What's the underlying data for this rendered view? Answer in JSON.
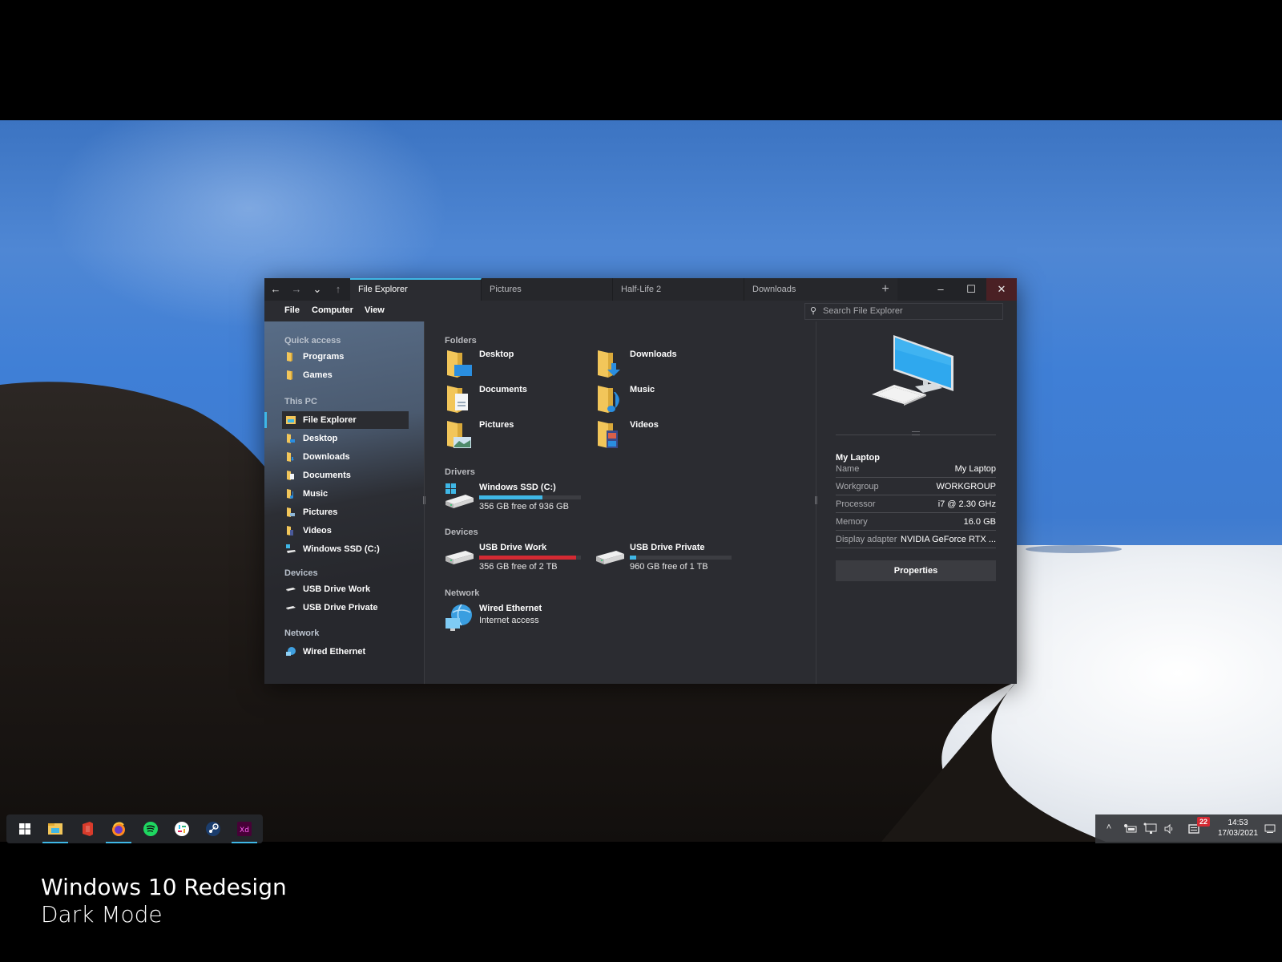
{
  "window": {
    "nav": {
      "back": "←",
      "forward": "→",
      "recent": "⌄",
      "up": "↑"
    },
    "tabs": [
      {
        "label": "File Explorer",
        "active": true
      },
      {
        "label": "Pictures",
        "active": false
      },
      {
        "label": "Half-Life 2",
        "active": false
      },
      {
        "label": "Downloads",
        "active": false
      }
    ],
    "new_tab": "+",
    "controls": {
      "minimize": "–",
      "maximize": "☐",
      "close": "✕"
    },
    "menu": [
      "File",
      "Computer",
      "View"
    ],
    "search_placeholder": "Search File Explorer"
  },
  "sidebar": {
    "sections": [
      {
        "label": "Quick access",
        "items": [
          {
            "label": "Programs",
            "icon": "folder-icon"
          },
          {
            "label": "Games",
            "icon": "folder-icon"
          }
        ]
      },
      {
        "label": "This PC",
        "items": [
          {
            "label": "File Explorer",
            "icon": "file-explorer-icon",
            "selected": true
          },
          {
            "label": "Desktop",
            "icon": "desktop-folder-icon"
          },
          {
            "label": "Downloads",
            "icon": "downloads-folder-icon"
          },
          {
            "label": "Documents",
            "icon": "documents-folder-icon"
          },
          {
            "label": "Music",
            "icon": "music-folder-icon"
          },
          {
            "label": "Pictures",
            "icon": "pictures-folder-icon"
          },
          {
            "label": "Videos",
            "icon": "videos-folder-icon"
          },
          {
            "label": "Windows SSD (C:)",
            "icon": "windows-drive-icon"
          }
        ]
      },
      {
        "label": "Devices",
        "items": [
          {
            "label": "USB Drive Work",
            "icon": "usb-drive-icon"
          },
          {
            "label": "USB Drive Private",
            "icon": "usb-drive-icon"
          }
        ]
      },
      {
        "label": "Network",
        "items": [
          {
            "label": "Wired Ethernet",
            "icon": "network-icon"
          }
        ]
      }
    ]
  },
  "main": {
    "folders_label": "Folders",
    "folders": [
      {
        "label": "Desktop",
        "icon": "desktop-folder-icon"
      },
      {
        "label": "Downloads",
        "icon": "downloads-folder-icon"
      },
      {
        "label": "Documents",
        "icon": "documents-folder-icon"
      },
      {
        "label": "Music",
        "icon": "music-folder-icon"
      },
      {
        "label": "Pictures",
        "icon": "pictures-folder-icon"
      },
      {
        "label": "Videos",
        "icon": "videos-folder-icon"
      }
    ],
    "drivers_label": "Drivers",
    "drivers": [
      {
        "label": "Windows SSD (C:)",
        "detail": "356 GB free of 936 GB",
        "used_fraction": 0.62,
        "status_color": "#3fb7e6"
      }
    ],
    "devices_label": "Devices",
    "devices": [
      {
        "label": "USB Drive Work",
        "detail": "356 GB free of 2 TB",
        "used_fraction": 0.95,
        "status_color": "#d42a33"
      },
      {
        "label": "USB Drive Private",
        "detail": "960 GB free of 1 TB",
        "used_fraction": 0.06,
        "status_color": "#3fb7e6"
      }
    ],
    "network_label": "Network",
    "network": [
      {
        "label": "Wired Ethernet",
        "detail": "Internet access"
      }
    ]
  },
  "details": {
    "title": "My Laptop",
    "properties": [
      {
        "key": "Name",
        "value": "My Laptop"
      },
      {
        "key": "Workgroup",
        "value": "WORKGROUP"
      },
      {
        "key": "Processor",
        "value": "i7 @ 2.30 GHz"
      },
      {
        "key": "Memory",
        "value": "16.0 GB"
      },
      {
        "key": "Display adapter",
        "value": "NVIDIA GeForce RTX ..."
      }
    ],
    "button": "Properties"
  },
  "taskbar": {
    "apps": [
      {
        "name": "start",
        "running": false
      },
      {
        "name": "file-explorer",
        "running": true
      },
      {
        "name": "office",
        "running": false
      },
      {
        "name": "firefox",
        "running": true
      },
      {
        "name": "spotify",
        "running": false
      },
      {
        "name": "slack",
        "running": false
      },
      {
        "name": "steam",
        "running": false
      },
      {
        "name": "adobe-xd",
        "running": true
      }
    ],
    "tray": {
      "chevron": "˄",
      "notifications_count": "22",
      "time": "14:53",
      "date": "17/03/2021"
    }
  },
  "caption": {
    "title": "Windows 10 Redesign",
    "subtitle": "Dark Mode"
  },
  "colors": {
    "accent": "#3fb7e6",
    "warning": "#d42a33",
    "window_bg": "#2b2c31",
    "titlebar_bg": "#222327"
  }
}
